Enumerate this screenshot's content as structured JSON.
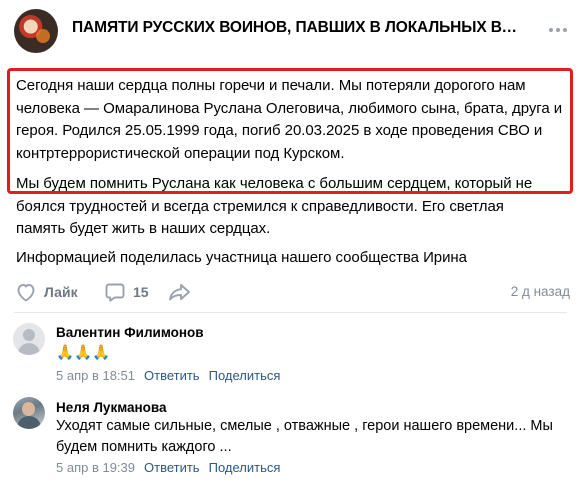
{
  "post": {
    "group_title": "ПАМЯТИ РУССКИХ ВОИНОВ, ПАВШИХ В ЛОКАЛЬНЫХ ВОЙН...",
    "paragraphs": [
      "Сегодня наши сердца полны горечи и печали. Мы потеряли дорогого нам человека — Омаралинова Руслана Олеговича, любимого сына, брата, друга и героя. Родился 25.05.1999 года, погиб 20.03.2025 в ходе проведения СВО и контртеррористической операции под Курском.",
      "Мы будем помнить Руслана как человека с большим сердцем, который не боялся трудностей и всегда стремился к справедливости. Его светлая память будет жить в наших сердцах.",
      "Информацией поделилась участница нашего сообщества Ирина"
    ],
    "like_label": "Лайк",
    "comment_count": "15",
    "time": "2 д назад"
  },
  "comments": [
    {
      "author": "Валентин Филимонов",
      "text": "🙏🙏🙏",
      "date": "5 апр в 18:51",
      "reply_label": "Ответить",
      "share_label": "Поделиться"
    },
    {
      "author": "Неля Лукманова",
      "text": "Уходят самые сильные, смелые , отважные , герои нашего времени... Мы будем помнить каждого ...",
      "date": "5 апр в 19:39",
      "reply_label": "Ответить",
      "share_label": "Поделиться"
    }
  ],
  "icons": {
    "more": "more-horizontal-icon",
    "like": "heart-outline-icon",
    "comment": "comment-bubble-icon",
    "share": "share-arrow-icon"
  },
  "colors": {
    "highlight_border": "#e21b24",
    "action_gray": "#6f7985",
    "meta_gray": "#818c99",
    "link_blue": "#2a5885",
    "icon_gray": "#99a2ad"
  }
}
